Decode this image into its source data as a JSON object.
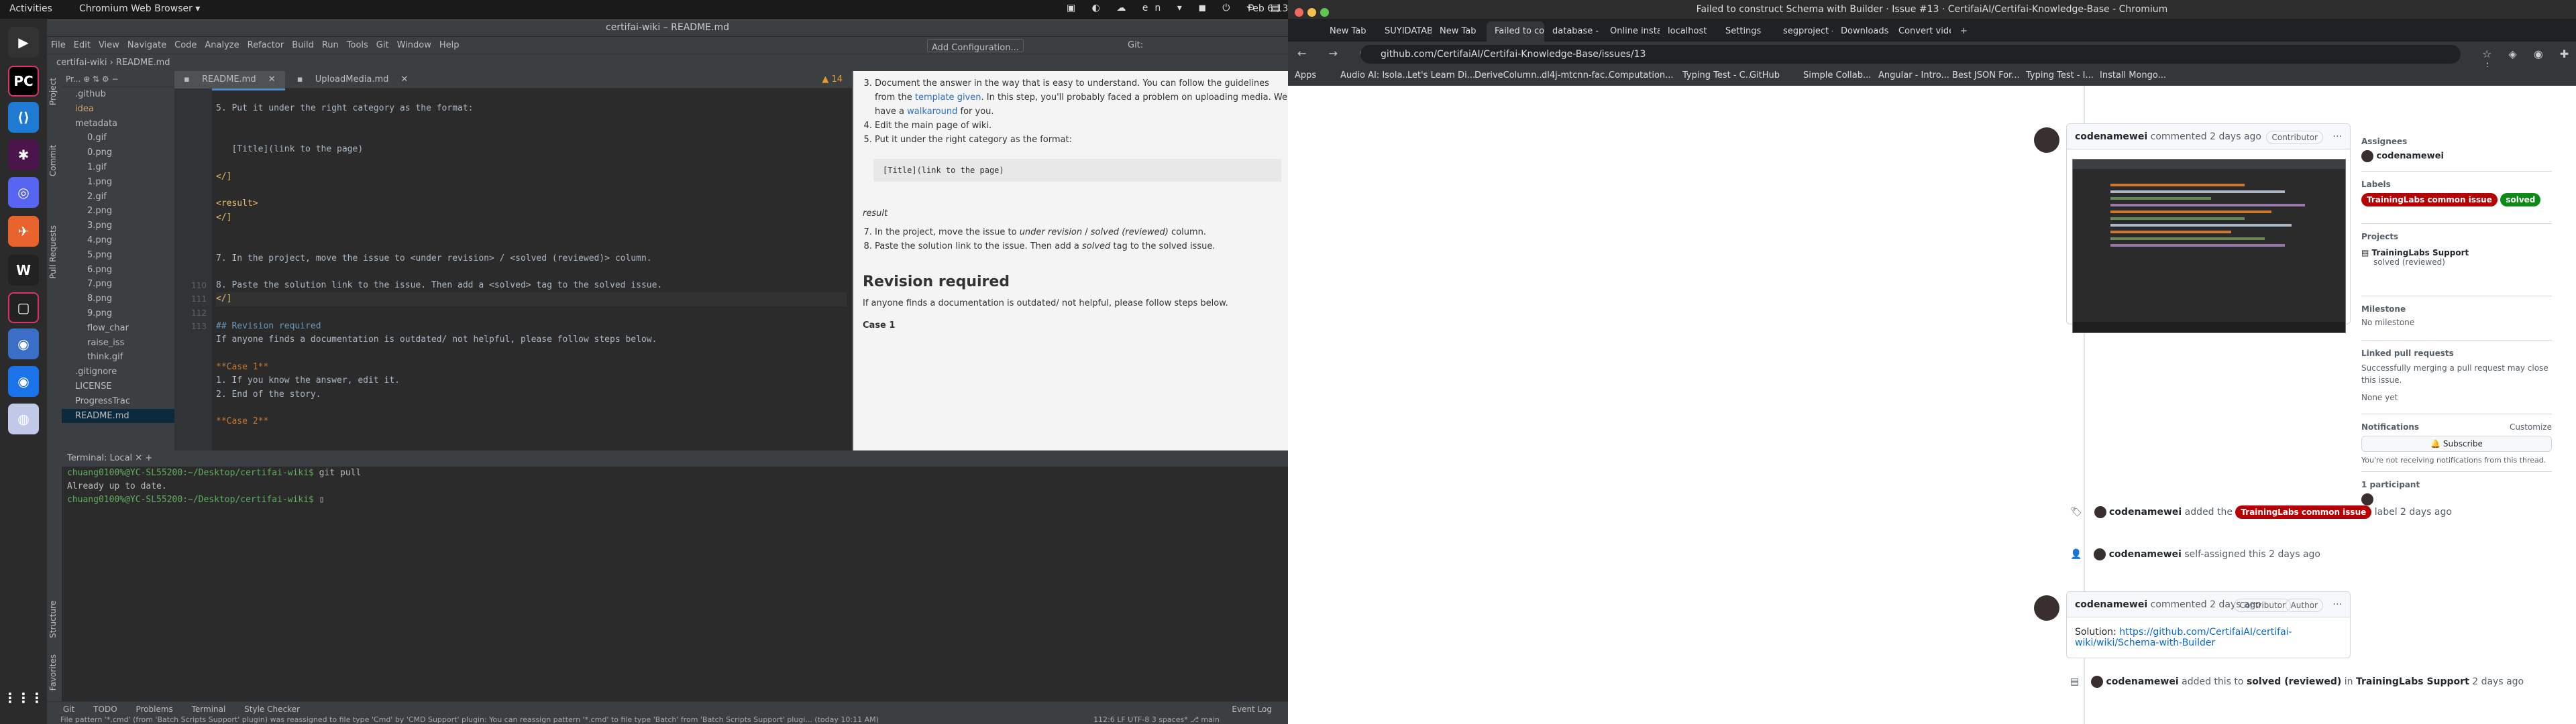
{
  "topbar": {
    "activities": "Activities",
    "app": "Chromium Web Browser ▾",
    "clock": "Feb 6 13:16",
    "lang": "en"
  },
  "ide": {
    "title": "certifai-wiki – README.md",
    "menu": [
      "File",
      "Edit",
      "View",
      "Navigate",
      "Code",
      "Analyze",
      "Refactor",
      "Build",
      "Run",
      "Tools",
      "Git",
      "Window",
      "Help"
    ],
    "breadcrumb_project": "certifai-wiki",
    "breadcrumb_file": "README.md",
    "run_config": "Add Configuration...",
    "git_label": "Git:",
    "project_header": "Pr...",
    "tree": [
      ".github",
      "idea",
      "metadata",
      "0.gif",
      "0.png",
      "1.gif",
      "1.png",
      "2.gif",
      "2.png",
      "3.png",
      "4.png",
      "5.png",
      "6.png",
      "7.png",
      "8.png",
      "9.png",
      "flow_char",
      "raise_iss",
      "think.gif",
      ".gitignore",
      "LICENSE",
      "ProgressTrac",
      "README.md"
    ],
    "tabs": [
      "README.md",
      "UploadMedia.md"
    ],
    "problems_count": "▲ 14",
    "line_numbers": [
      "",
      "",
      "",
      "",
      "",
      "",
      "",
      "",
      "",
      "",
      "",
      "",
      "",
      "",
      "110",
      "111",
      "112",
      "113",
      "",
      "",
      "",
      "",
      "",
      "",
      "",
      ""
    ],
    "code_lines": [
      "",
      "5. Put it under the right category as the format:",
      "",
      "",
      "   [Title](link to the page)",
      "",
      "</]",
      "",
      "<result>",
      "</]",
      "",
      "",
      "7. In the project, move the issue to <under revision> / <solved (reviewed)> column.",
      "",
      "8. Paste the solution link to the issue. Then add a <solved> tag to the solved issue.",
      "</]",
      "",
      "## Revision required",
      "If anyone finds a documentation is outdated/ not helpful, please follow steps below.",
      "",
      "**Case 1**",
      "1. If you know the answer, edit it.",
      "2. End of the story.",
      "",
      "**Case 2**",
      ""
    ],
    "preview": {
      "item3": "Document the answer in the way that is easy to understand. You can follow the guidelines from the",
      "template_link": "template given",
      "item3b": ". In this step, you'll probably faced a problem on uploading media. We have a",
      "walkaround_link": "walkaround",
      "item3c": " for you.",
      "item4": "Edit the main page of wiki.",
      "item5": "Put it under the right category as the format:",
      "pre": "[Title](link to the page)",
      "result": "result",
      "item7a": "In the project, move the issue to ",
      "item7_em": "under revision",
      "item7b": " / ",
      "item7_em2": "solved (reviewed)",
      "item7c": " column.",
      "item8": "Paste the solution link to the issue. Then add a ",
      "item8_em": "solved",
      "item8b": " tag to the solved issue.",
      "heading": "Revision required",
      "para": "If anyone finds a documentation is outdated/ not helpful, please follow steps below.",
      "case1": "Case 1"
    },
    "terminal": {
      "header": "Terminal:",
      "tab": "Local",
      "prompt1": "chuang0100%@YC-SL55200:~/Desktop/certifai-wiki$",
      "cmd1": " git pull",
      "out1": "Already up to date.",
      "prompt2": "chuang0100%@YC-SL55200:~/Desktop/certifai-wiki$"
    },
    "bottom_tools": [
      "Git",
      "TODO",
      "Problems",
      "Terminal",
      "Style Checker"
    ],
    "event_log": "Event Log",
    "status_msg": "File pattern '*.cmd' (from 'Batch Scripts Support' plugin) was reassigned to file type 'Cmd' by 'CMD Support' plugin: You can reassign pattern '*.cmd' to file type 'Batch' from 'Batch Scripts Support' plugi... (today 10:11 AM)",
    "status_right": "112:6  LF  UTF-8  3 spaces*  ⎇ main"
  },
  "browser": {
    "window_title": "Failed to construct Schema with Builder · Issue #13 · CertifaiAI/Certifai-Knowledge-Base - Chromium",
    "tabs": [
      "New Tab",
      "SUYIDATABASE",
      "New Tab",
      "Failed to cons",
      "database - How",
      "Online instanc",
      "localhost",
      "Settings",
      "segproject - Co",
      "Downloads",
      "Convert video"
    ],
    "url": "github.com/CertifaiAI/Certifai-Knowledge-Base/issues/13",
    "bookmarks": [
      "Apps",
      "Audio AI: Isola...",
      "Let's Learn Di...",
      "DeriveColumn...",
      "dl4j-mtcnn-fac...",
      "Computation...",
      "Typing Test - C...",
      "GitHub",
      "Simple Collab...",
      "Angular - Intro...",
      "Best JSON For...",
      "Typing Test - I...",
      "Install Mongo..."
    ],
    "comment1": {
      "author": "codenamewei",
      "meta": "commented 2 days ago",
      "badge": "Contributor"
    },
    "event_label": {
      "author": "codenamewei",
      "pre": "added the",
      "label": "TrainingLabs common issue",
      "post": "label 2 days ago"
    },
    "event_assign": {
      "author": "codenamewei",
      "text": "self-assigned this 2 days ago"
    },
    "comment2": {
      "author": "codenamewei",
      "meta": "commented 2 days ago",
      "badge1": "Contributor",
      "badge2": "Author",
      "body_pre": "Solution:",
      "link": "https://github.com/CertifaiAI/certifai-wiki/wiki/Schema-with-Builder"
    },
    "event_project": {
      "author": "codenamewei",
      "pre": "added this to",
      "column": "solved (reviewed)",
      "mid": "in",
      "project": "TrainingLabs Support",
      "post": "2 days ago"
    },
    "sidebar": {
      "assignees_h": "Assignees",
      "assignee": "codenamewei",
      "labels_h": "Labels",
      "label1": "TrainingLabs common issue",
      "label2": "solved",
      "projects_h": "Projects",
      "project": "TrainingLabs Support",
      "project_status": "solved (reviewed)",
      "milestone_h": "Milestone",
      "milestone": "No milestone",
      "linked_h": "Linked pull requests",
      "linked": "Successfully merging a pull request may close this issue.",
      "linked2": "None yet",
      "notif_h": "Notifications",
      "customize": "Customize",
      "subscribe": "Subscribe",
      "notif_text": "You're not receiving notifications from this thread.",
      "participants_h": "1 participant"
    }
  }
}
